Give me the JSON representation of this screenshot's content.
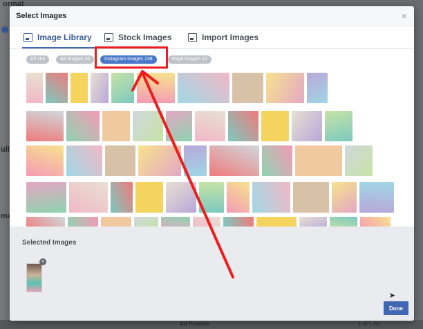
{
  "background_page": {
    "fragments": [
      "ormat",
      "ulls",
      "ma",
      "Ad Preview",
      "1 of 1 Ad"
    ]
  },
  "dialog": {
    "title": "Select Images",
    "tabs": [
      {
        "label": "Image Library",
        "icon": "image-library-icon",
        "active": true
      },
      {
        "label": "Stock Images",
        "icon": "stock-images-icon",
        "active": false
      },
      {
        "label": "Import Images",
        "icon": "import-images-icon",
        "active": false
      }
    ],
    "filters": [
      {
        "label": "All 163",
        "active": false
      },
      {
        "label": "Ad Images 36",
        "active": false
      },
      {
        "label": "Instagram Images 138",
        "active": true
      },
      {
        "label": "Page Images 12",
        "active": false
      }
    ],
    "selected_title": "Selected Images",
    "done_label": "Done"
  },
  "colors": {
    "accent": "#4267b2",
    "annotation": "#ee1c1c"
  }
}
